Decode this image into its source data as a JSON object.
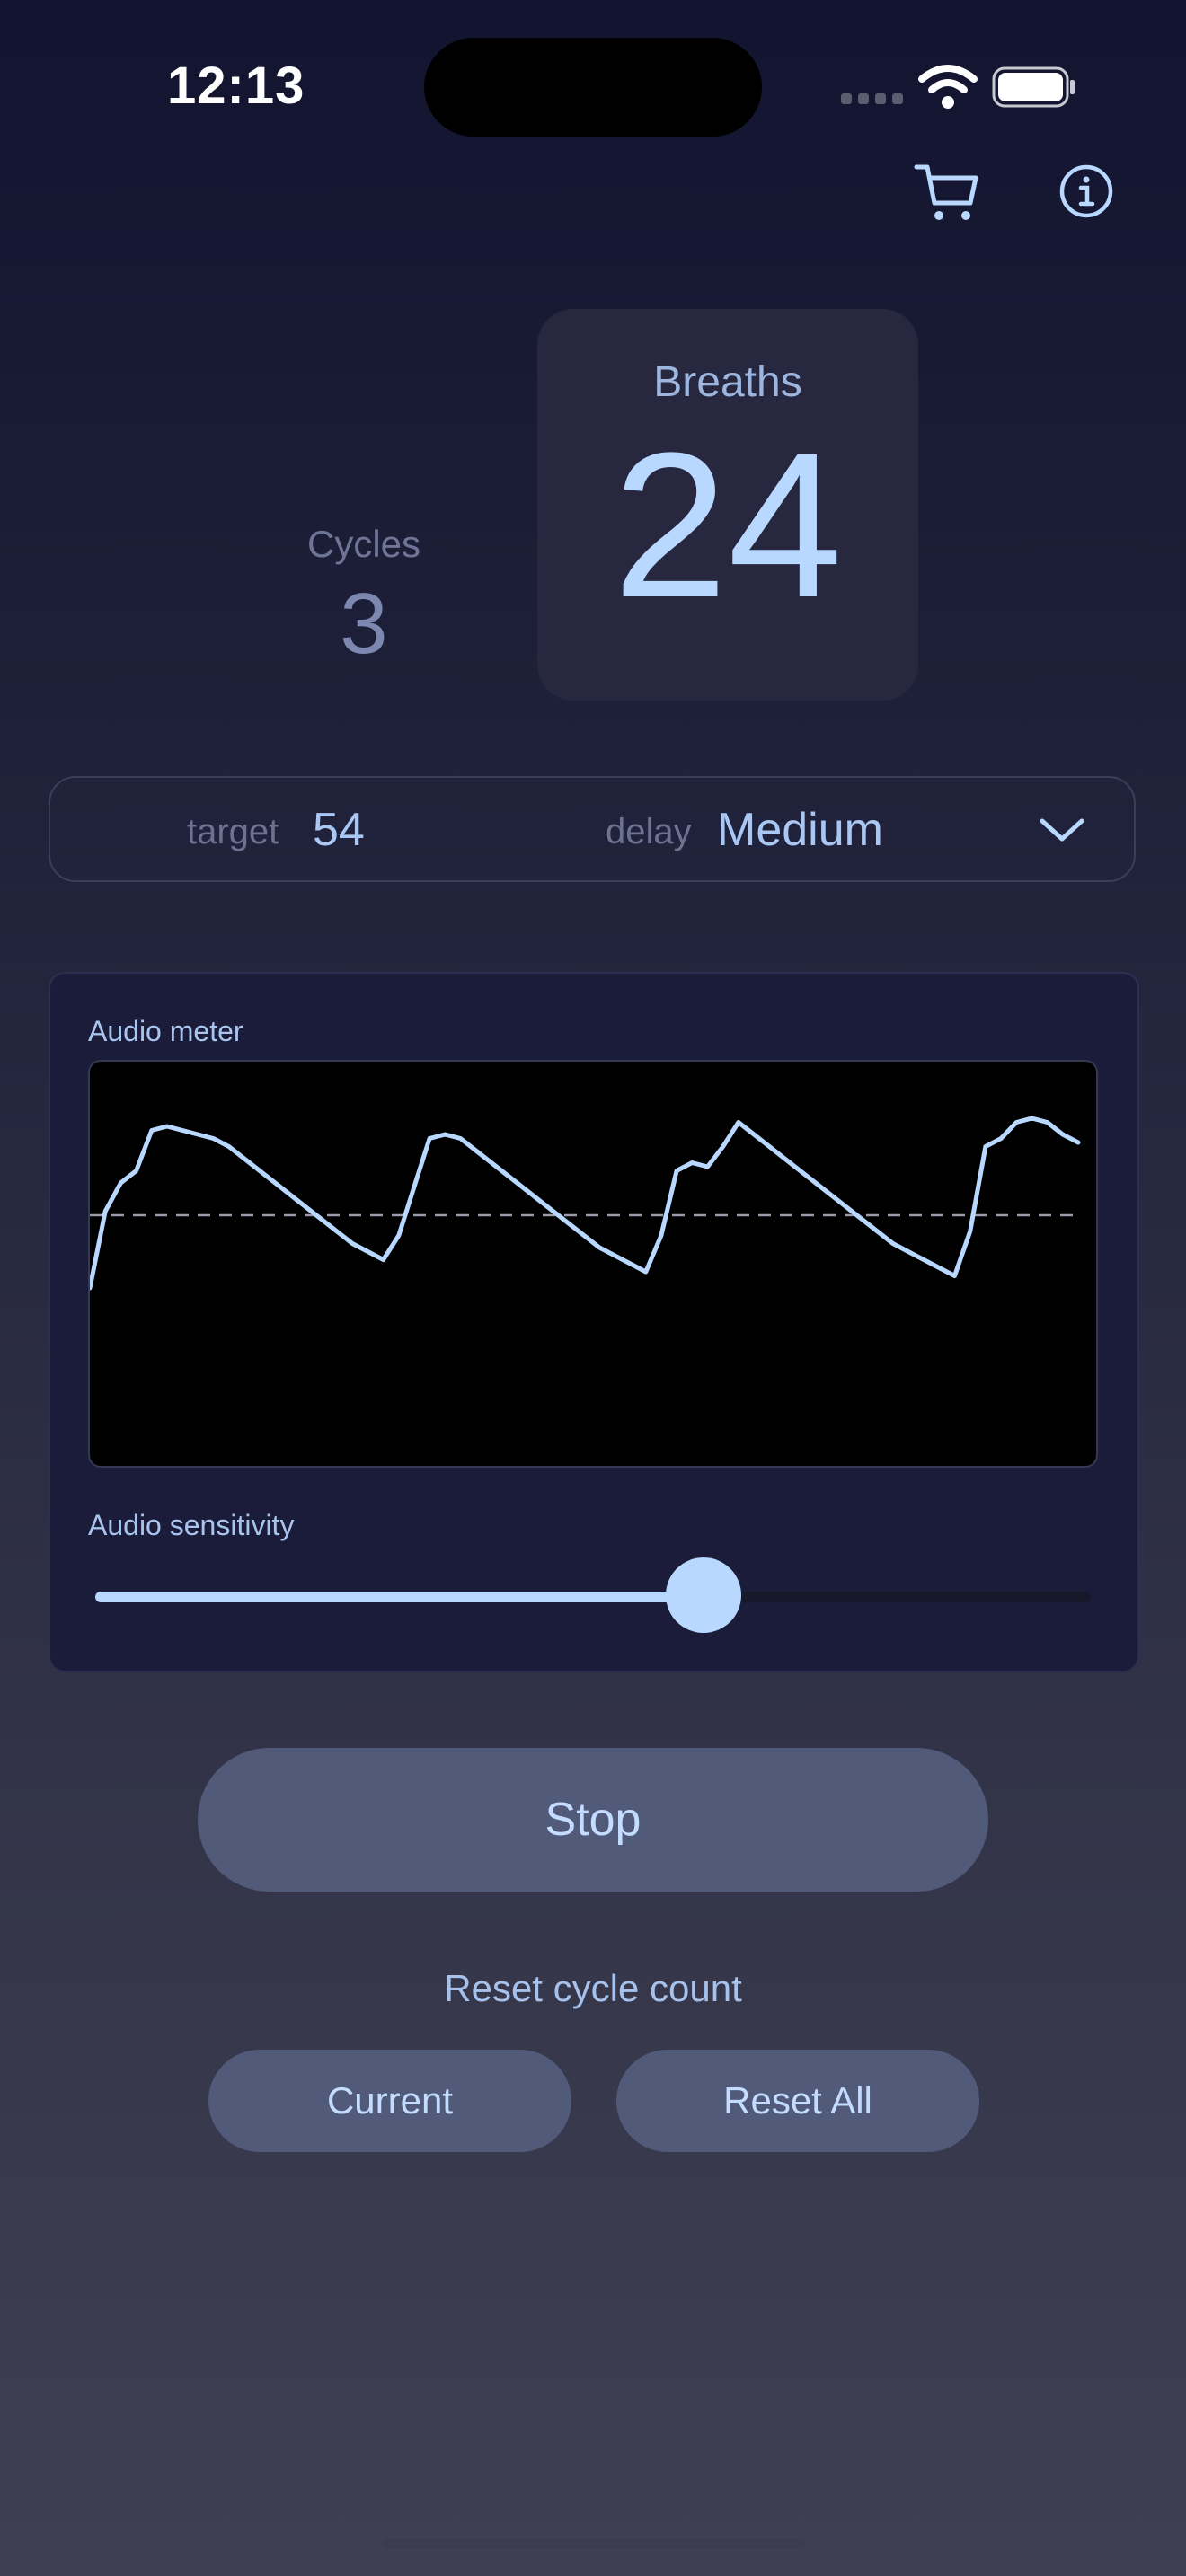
{
  "status_bar": {
    "time": "12:13"
  },
  "icons": {
    "cart": "cart-icon",
    "info": "info-icon",
    "chevron": "chevron-down-icon",
    "wifi": "wifi-icon",
    "battery": "battery-icon"
  },
  "counters": {
    "cycles_label": "Cycles",
    "cycles_value": "3",
    "breaths_label": "Breaths",
    "breaths_value": "24"
  },
  "settings": {
    "target_label": "target",
    "target_value": "54",
    "delay_label": "delay",
    "delay_value": "Medium"
  },
  "audio": {
    "meter_label": "Audio meter",
    "sensitivity_label": "Audio sensitivity",
    "sensitivity_value": 0.62
  },
  "chart_data": {
    "type": "line",
    "series": [
      {
        "values": [
          0.44,
          0.63,
          0.7,
          0.73,
          0.83,
          0.84,
          0.83,
          0.82,
          0.81,
          0.79,
          0.76,
          0.73,
          0.7,
          0.67,
          0.64,
          0.61,
          0.58,
          0.55,
          0.53,
          0.51,
          0.57,
          0.69,
          0.81,
          0.82,
          0.81,
          0.78,
          0.75,
          0.72,
          0.69,
          0.66,
          0.63,
          0.6,
          0.57,
          0.54,
          0.52,
          0.5,
          0.48,
          0.57,
          0.73,
          0.75,
          0.74,
          0.79,
          0.85,
          0.82,
          0.79,
          0.76,
          0.73,
          0.7,
          0.67,
          0.64,
          0.61,
          0.58,
          0.55,
          0.53,
          0.51,
          0.49,
          0.47,
          0.58,
          0.79,
          0.81,
          0.85,
          0.86,
          0.85,
          0.82,
          0.8
        ]
      }
    ],
    "threshold": 0.62,
    "ylim": [
      0,
      1
    ],
    "grid": false
  },
  "controls": {
    "stop_label": "Stop",
    "reset_label": "Reset cycle count",
    "current_label": "Current",
    "reset_all_label": "Reset All"
  }
}
